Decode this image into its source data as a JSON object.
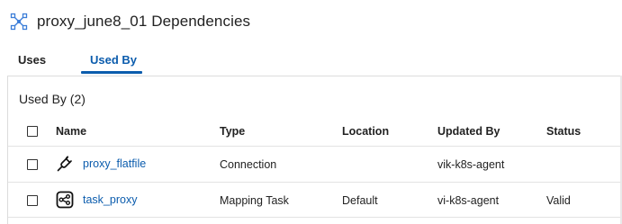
{
  "header": {
    "title": "proxy_june8_01 Dependencies"
  },
  "tabs": [
    {
      "label": "Uses",
      "active": false
    },
    {
      "label": "Used By",
      "active": true
    }
  ],
  "section": {
    "title": "Used By (2)"
  },
  "table": {
    "columns": [
      "Name",
      "Type",
      "Location",
      "Updated By",
      "Status"
    ],
    "rows": [
      {
        "name": "proxy_flatfile",
        "icon": "connection-plug-icon",
        "type": "Connection",
        "location": "",
        "updated_by": "vik-k8s-agent",
        "status": ""
      },
      {
        "name": "task_proxy",
        "icon": "mapping-task-icon",
        "type": "Mapping Task",
        "location": "Default",
        "updated_by": "vi-k8s-agent",
        "status": "Valid"
      }
    ]
  },
  "colors": {
    "accent": "#0b5cad",
    "text": "#222222",
    "border": "#dcdcdc"
  }
}
